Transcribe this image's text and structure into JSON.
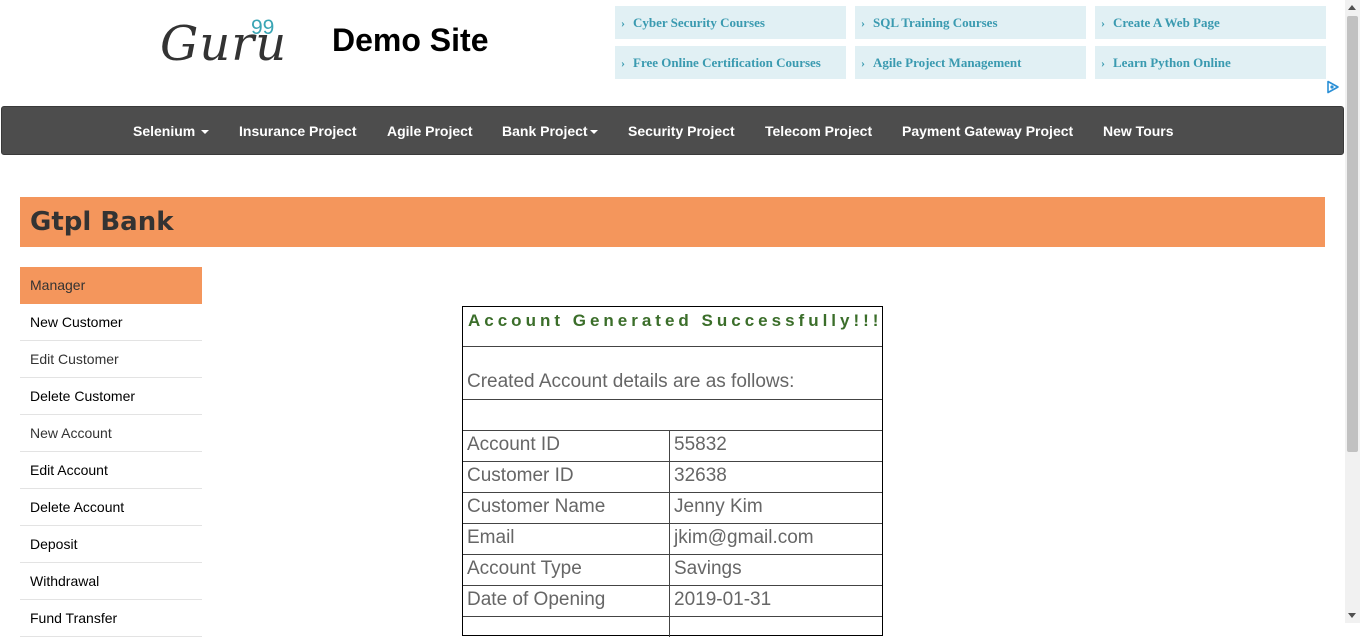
{
  "header": {
    "logo_text": "Guru",
    "logo_sup": "99",
    "site_title": "Demo Site"
  },
  "ads": [
    {
      "label": "Cyber Security Courses"
    },
    {
      "label": "SQL Training Courses"
    },
    {
      "label": "Create A Web Page"
    },
    {
      "label": "Free Online Certification Courses"
    },
    {
      "label": "Agile Project Management"
    },
    {
      "label": "Learn Python Online"
    }
  ],
  "nav": {
    "items": [
      {
        "label": "Selenium",
        "has_caret": true
      },
      {
        "label": "Insurance Project"
      },
      {
        "label": "Agile Project"
      },
      {
        "label": "Bank Project",
        "has_caret": true
      },
      {
        "label": "Security Project"
      },
      {
        "label": "Telecom Project"
      },
      {
        "label": "Payment Gateway Project"
      },
      {
        "label": "New Tours"
      }
    ]
  },
  "bank": {
    "title": "Gtpl Bank"
  },
  "sidebar": {
    "items": [
      {
        "label": "Manager",
        "active": true
      },
      {
        "label": "New Customer"
      },
      {
        "label": "Edit Customer"
      },
      {
        "label": "Delete Customer"
      },
      {
        "label": "New Account"
      },
      {
        "label": "Edit Account"
      },
      {
        "label": "Delete Account"
      },
      {
        "label": "Deposit"
      },
      {
        "label": "Withdrawal"
      },
      {
        "label": "Fund Transfer"
      }
    ]
  },
  "result": {
    "success_message": "Account Generated Successfully!!!",
    "details_heading": "Created Account details are as follows:",
    "rows": [
      {
        "label": "Account ID",
        "value": "55832"
      },
      {
        "label": "Customer ID",
        "value": "32638"
      },
      {
        "label": "Customer Name",
        "value": "Jenny Kim"
      },
      {
        "label": "Email",
        "value": "jkim@gmail.com"
      },
      {
        "label": "Account Type",
        "value": "Savings"
      },
      {
        "label": "Date of Opening",
        "value": "2019-01-31"
      }
    ]
  },
  "colors": {
    "accent": "#f4965c",
    "navbar": "#4d4d4d",
    "ad_bg": "#e1f0f4",
    "ad_text": "#3a9ab0",
    "success_text": "#3b6e2a"
  }
}
